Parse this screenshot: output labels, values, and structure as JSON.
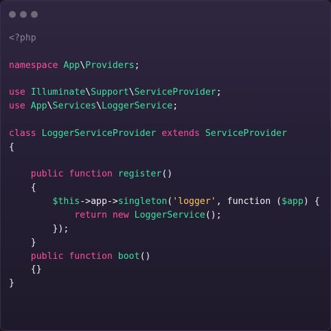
{
  "window": {
    "controls": [
      "window-dot",
      "window-dot",
      "window-dot"
    ]
  },
  "code": {
    "lines": [
      [
        {
          "t": "<?php",
          "c": "php"
        }
      ],
      [],
      [
        {
          "t": "namespace ",
          "c": "kw"
        },
        {
          "t": "App",
          "c": "ns"
        },
        {
          "t": "\\",
          "c": "p"
        },
        {
          "t": "Providers",
          "c": "ns"
        },
        {
          "t": ";",
          "c": "p"
        }
      ],
      [],
      [
        {
          "t": "use ",
          "c": "kw"
        },
        {
          "t": "Illuminate",
          "c": "ns"
        },
        {
          "t": "\\",
          "c": "p"
        },
        {
          "t": "Support",
          "c": "ns"
        },
        {
          "t": "\\",
          "c": "p"
        },
        {
          "t": "ServiceProvider",
          "c": "ns"
        },
        {
          "t": ";",
          "c": "p"
        }
      ],
      [
        {
          "t": "use ",
          "c": "kw"
        },
        {
          "t": "App",
          "c": "ns"
        },
        {
          "t": "\\",
          "c": "p"
        },
        {
          "t": "Services",
          "c": "ns"
        },
        {
          "t": "\\",
          "c": "p"
        },
        {
          "t": "LoggerService",
          "c": "ns"
        },
        {
          "t": ";",
          "c": "p"
        }
      ],
      [],
      [
        {
          "t": "class ",
          "c": "kw"
        },
        {
          "t": "LoggerServiceProvider",
          "c": "cls"
        },
        {
          "t": " extends ",
          "c": "kw"
        },
        {
          "t": "ServiceProvider",
          "c": "cls"
        }
      ],
      [
        {
          "t": "{",
          "c": "p"
        }
      ],
      [],
      [
        {
          "t": "    public function ",
          "c": "kw"
        },
        {
          "t": "register",
          "c": "fn"
        },
        {
          "t": "()",
          "c": "p"
        }
      ],
      [
        {
          "t": "    {",
          "c": "p"
        }
      ],
      [
        {
          "t": "        ",
          "c": "p"
        },
        {
          "t": "$this",
          "c": "var"
        },
        {
          "t": "->app->",
          "c": "p"
        },
        {
          "t": "singleton",
          "c": "fn"
        },
        {
          "t": "(",
          "c": "p"
        },
        {
          "t": "'logger'",
          "c": "str"
        },
        {
          "t": ", function (",
          "c": "p"
        },
        {
          "t": "$app",
          "c": "var"
        },
        {
          "t": ") {",
          "c": "p"
        }
      ],
      [
        {
          "t": "            return new ",
          "c": "kw"
        },
        {
          "t": "LoggerService",
          "c": "cls"
        },
        {
          "t": "();",
          "c": "p"
        }
      ],
      [
        {
          "t": "        });",
          "c": "p"
        }
      ],
      [
        {
          "t": "    }",
          "c": "p"
        }
      ],
      [
        {
          "t": "    public function ",
          "c": "kw"
        },
        {
          "t": "boot",
          "c": "fn"
        },
        {
          "t": "()",
          "c": "p"
        }
      ],
      [
        {
          "t": "    {}",
          "c": "p"
        }
      ],
      [
        {
          "t": "}",
          "c": "p"
        }
      ]
    ]
  }
}
